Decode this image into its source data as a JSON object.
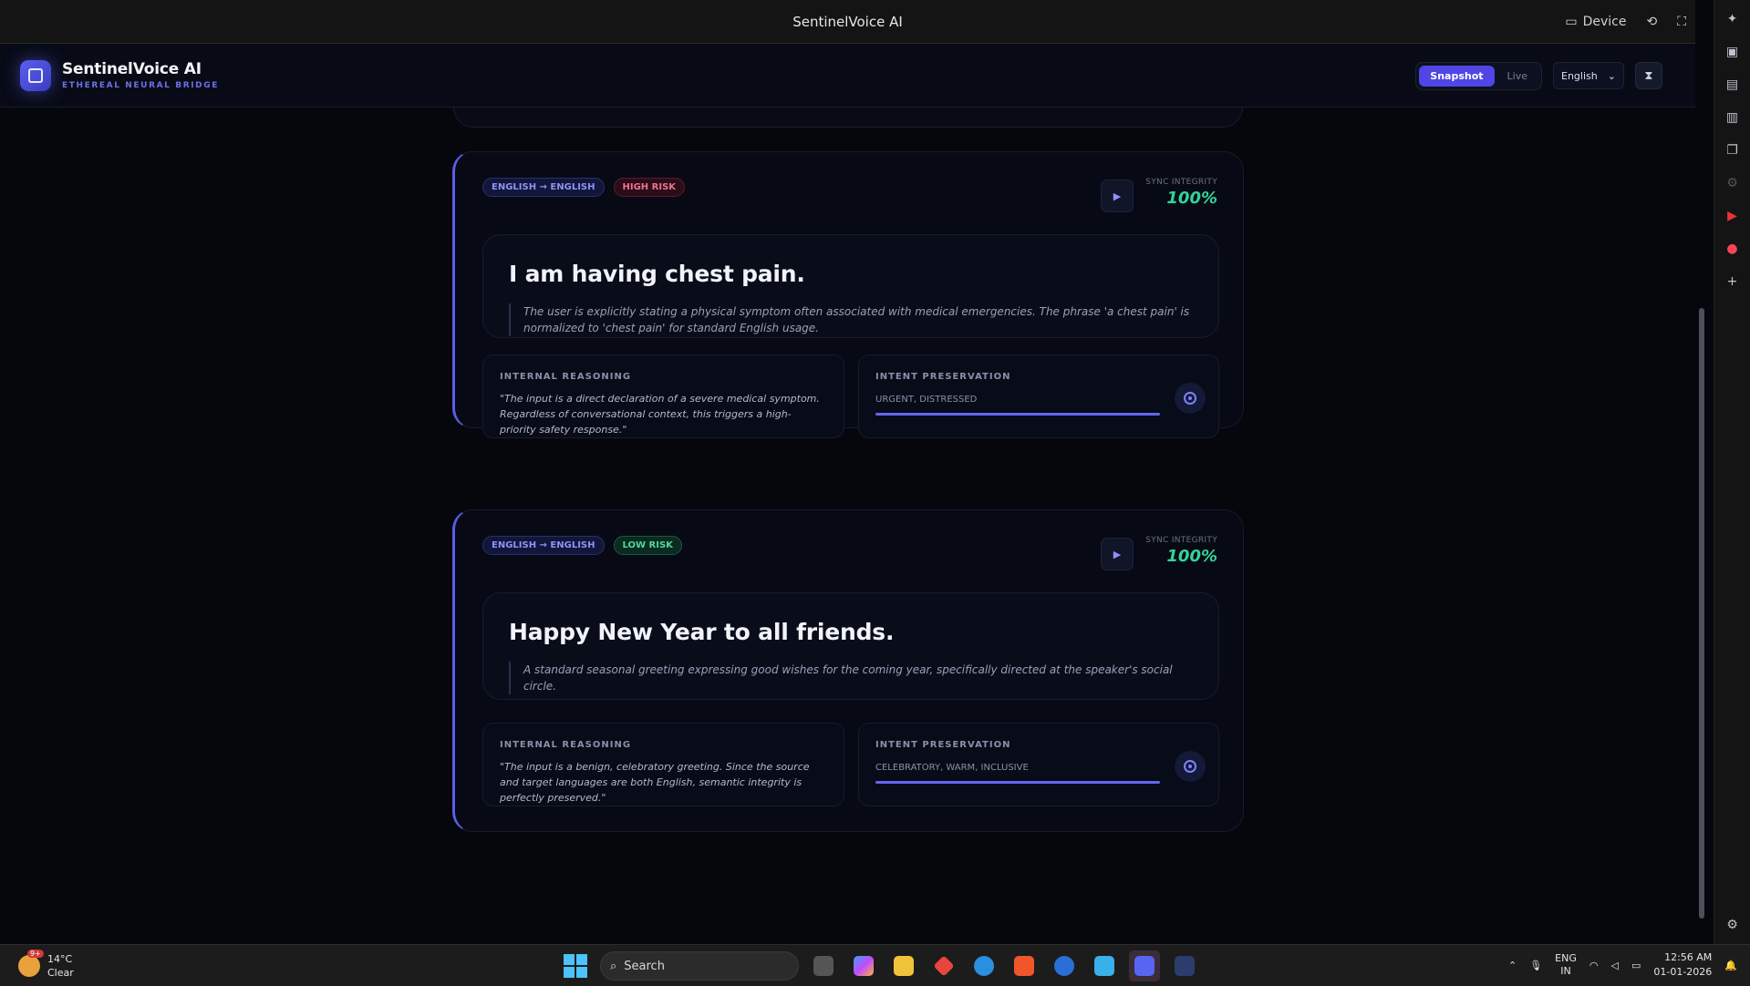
{
  "window": {
    "title": "SentinelVoice AI",
    "device_label": "Device"
  },
  "header": {
    "app_name": "SentinelVoice AI",
    "tagline": "ETHEREAL NEURAL BRIDGE",
    "mode_snapshot": "Snapshot",
    "mode_live": "Live",
    "language": "English"
  },
  "cards": [
    {
      "lang_pair": "ENGLISH → ENGLISH",
      "risk": "HIGH RISK",
      "sync_label": "SYNC INTEGRITY",
      "sync_value": "100%",
      "heading": "I am having chest pain.",
      "note": "The user is explicitly stating a physical symptom often associated with medical emergencies. The phrase 'a chest pain' is normalized to 'chest pain' for standard English usage.",
      "reasoning_label": "INTERNAL REASONING",
      "reasoning": "\"The input is a direct declaration of a severe medical symptom. Regardless of conversational context, this triggers a high-priority safety response.\"",
      "intent_label": "INTENT PRESERVATION",
      "intent_tags": "URGENT, DISTRESSED",
      "intent_fill": 1.0
    },
    {
      "lang_pair": "ENGLISH → ENGLISH",
      "risk": "LOW RISK",
      "sync_label": "SYNC INTEGRITY",
      "sync_value": "100%",
      "heading": "Happy New Year to all friends.",
      "note": "A standard seasonal greeting expressing good wishes for the coming year, specifically directed at the speaker's social circle.",
      "reasoning_label": "INTERNAL REASONING",
      "reasoning": "\"The input is a benign, celebratory greeting. Since the source and target languages are both English, semantic integrity is perfectly preserved.\"",
      "intent_label": "INTENT PRESERVATION",
      "intent_tags": "CELEBRATORY, WARM, INCLUSIVE",
      "intent_fill": 1.0
    }
  ],
  "taskbar": {
    "weather_temp": "14°C",
    "weather_desc": "Clear",
    "weather_badge": "9+",
    "search_label": "Search",
    "lang_top": "ENG",
    "lang_bottom": "IN",
    "time": "12:56 AM",
    "date": "01-01-2026"
  },
  "colors": {
    "accent": "#5a5ee6",
    "success": "#34d399",
    "danger": "#f07090"
  }
}
